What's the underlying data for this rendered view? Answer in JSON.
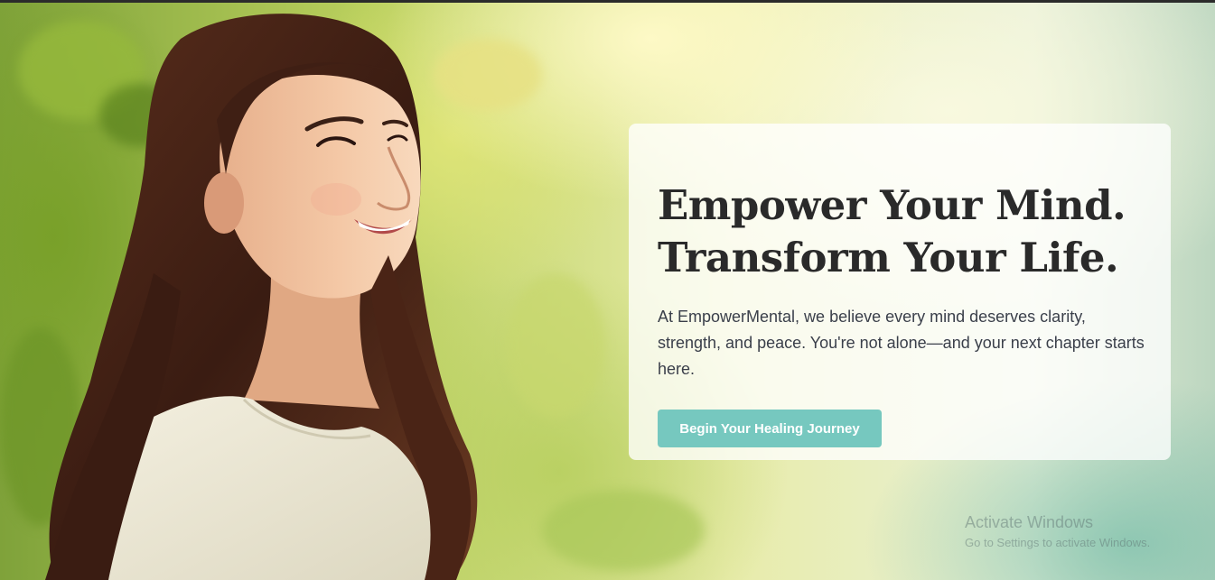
{
  "hero": {
    "headline_line1": "Empower Your Mind.",
    "headline_line2": "Transform Your Life.",
    "lead": "At EmpowerMental, we believe every mind deserves clarity, strength, and peace. You're not alone—and your next chapter starts here.",
    "cta_label": "Begin Your Healing Journey"
  },
  "watermark": {
    "title": "Activate Windows",
    "subtitle": "Go to Settings to activate Windows."
  },
  "colors": {
    "accent": "#76c8bf",
    "headline": "#2a2a2a",
    "body_text": "#3a3f4a"
  }
}
